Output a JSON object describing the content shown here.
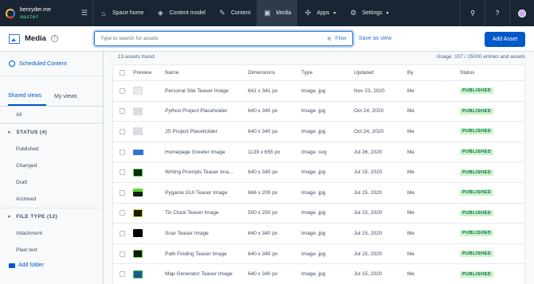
{
  "space": {
    "name": "benryder.me",
    "environment": "master"
  },
  "nav": {
    "items": [
      {
        "label": "Space home",
        "icon": "home-icon"
      },
      {
        "label": "Content model",
        "icon": "cube-icon"
      },
      {
        "label": "Content",
        "icon": "pencil-icon"
      },
      {
        "label": "Media",
        "icon": "image-icon"
      },
      {
        "label": "Apps",
        "icon": "puzzle-icon"
      },
      {
        "label": "Settings",
        "icon": "gear-icon"
      }
    ]
  },
  "header": {
    "title": "Media",
    "search_placeholder": "Type to search for assets",
    "filter_label": "Filter",
    "save_view_label": "Save as view",
    "add_asset_label": "Add Asset"
  },
  "sidebar": {
    "scheduled_label": "Scheduled Content",
    "tabs": [
      "Shared views",
      "My views"
    ],
    "all_label": "All",
    "status_group": "STATUS (4)",
    "status_items": [
      "Published",
      "Changed",
      "Draft",
      "Archived"
    ],
    "filetype_group": "FILE TYPE (12)",
    "filetype_items": [
      "Attachment",
      "Plain text"
    ],
    "add_folder_label": "Add folder"
  },
  "main": {
    "count_label": "13 assets found",
    "usage_label": "Usage: 107 / 25000 entries and assets",
    "columns": [
      "Preview",
      "Name",
      "Dimensions",
      "Type",
      "Updated",
      "By",
      "Status"
    ],
    "rows": [
      {
        "name": "Personal Site Teaser Image",
        "dimensions": "641 x 341 px",
        "type": "Image .jpg",
        "updated": "Nov 23, 2020",
        "by": "Me",
        "status": "PUBLISHED",
        "thumb": "light"
      },
      {
        "name": "Python Project Placeholder",
        "dimensions": "640 x 340 px",
        "type": "Image .jpg",
        "updated": "Oct 24, 2020",
        "by": "Me",
        "status": "PUBLISHED",
        "thumb": "grey"
      },
      {
        "name": "JS Project Placeholder",
        "dimensions": "640 x 340 px",
        "type": "Image .jpg",
        "updated": "Oct 24, 2020",
        "by": "Me",
        "status": "PUBLISHED",
        "thumb": "grey"
      },
      {
        "name": "Homepage Greeter Image",
        "dimensions": "1139 x 655 px",
        "type": "Image .svg",
        "updated": "Jul 26, 2020",
        "by": "Me",
        "status": "PUBLISHED",
        "thumb": "blue"
      },
      {
        "name": "Writing Prompts Teaser Ima...",
        "dimensions": "640 x 340 px",
        "type": "Image .jpg",
        "updated": "Jul 15, 2020",
        "by": "Me",
        "status": "PUBLISHED",
        "thumb": "green"
      },
      {
        "name": "Pygame GUI Teaser Image",
        "dimensions": "666 x 200 px",
        "type": "Image .jpg",
        "updated": "Jul 15, 2020",
        "by": "Me",
        "status": "PUBLISHED",
        "thumb": "pyg"
      },
      {
        "name": "Tix Clock Teaser Image",
        "dimensions": "500 x 250 px",
        "type": "Image .jpg",
        "updated": "Jul 15, 2020",
        "by": "Me",
        "status": "PUBLISHED",
        "thumb": "tix"
      },
      {
        "name": "Soar Teaser Image",
        "dimensions": "640 x 340 px",
        "type": "Image .jpg",
        "updated": "Jul 15, 2020",
        "by": "Me",
        "status": "PUBLISHED",
        "thumb": "soar"
      },
      {
        "name": "Path Finding Teaser Image",
        "dimensions": "640 x 340 px",
        "type": "Image .jpg",
        "updated": "Jul 15, 2020",
        "by": "Me",
        "status": "PUBLISHED",
        "thumb": "path"
      },
      {
        "name": "Map Generator Teaser Image",
        "dimensions": "640 x 340 px",
        "type": "Image .jpg",
        "updated": "Jul 15, 2020",
        "by": "Me",
        "status": "PUBLISHED",
        "thumb": "map"
      }
    ]
  },
  "colors": {
    "nav_bg": "#192532",
    "accent": "#0059c8",
    "published_bg": "#cdf3c6",
    "published_text": "#006a59"
  }
}
